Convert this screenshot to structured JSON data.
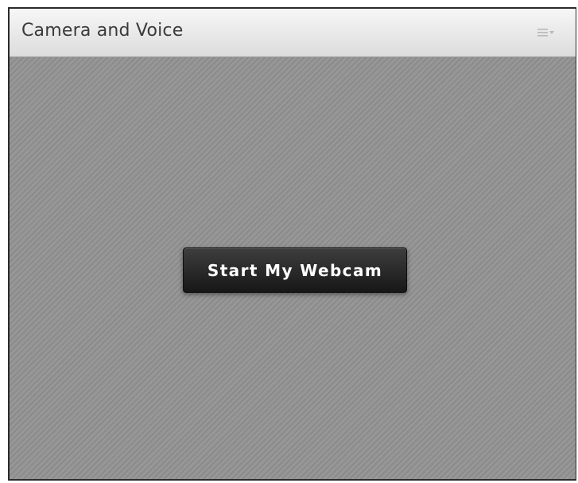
{
  "pod": {
    "title": "Camera and Voice",
    "menu_icon": "pod-options-menu-icon"
  },
  "camera": {
    "start_button_label": "Start My Webcam"
  },
  "colors": {
    "header_bg": "#e6e6e6",
    "body_stripes": "#8e8e8e",
    "button_bg": "#262626",
    "button_text": "#ffffff"
  }
}
